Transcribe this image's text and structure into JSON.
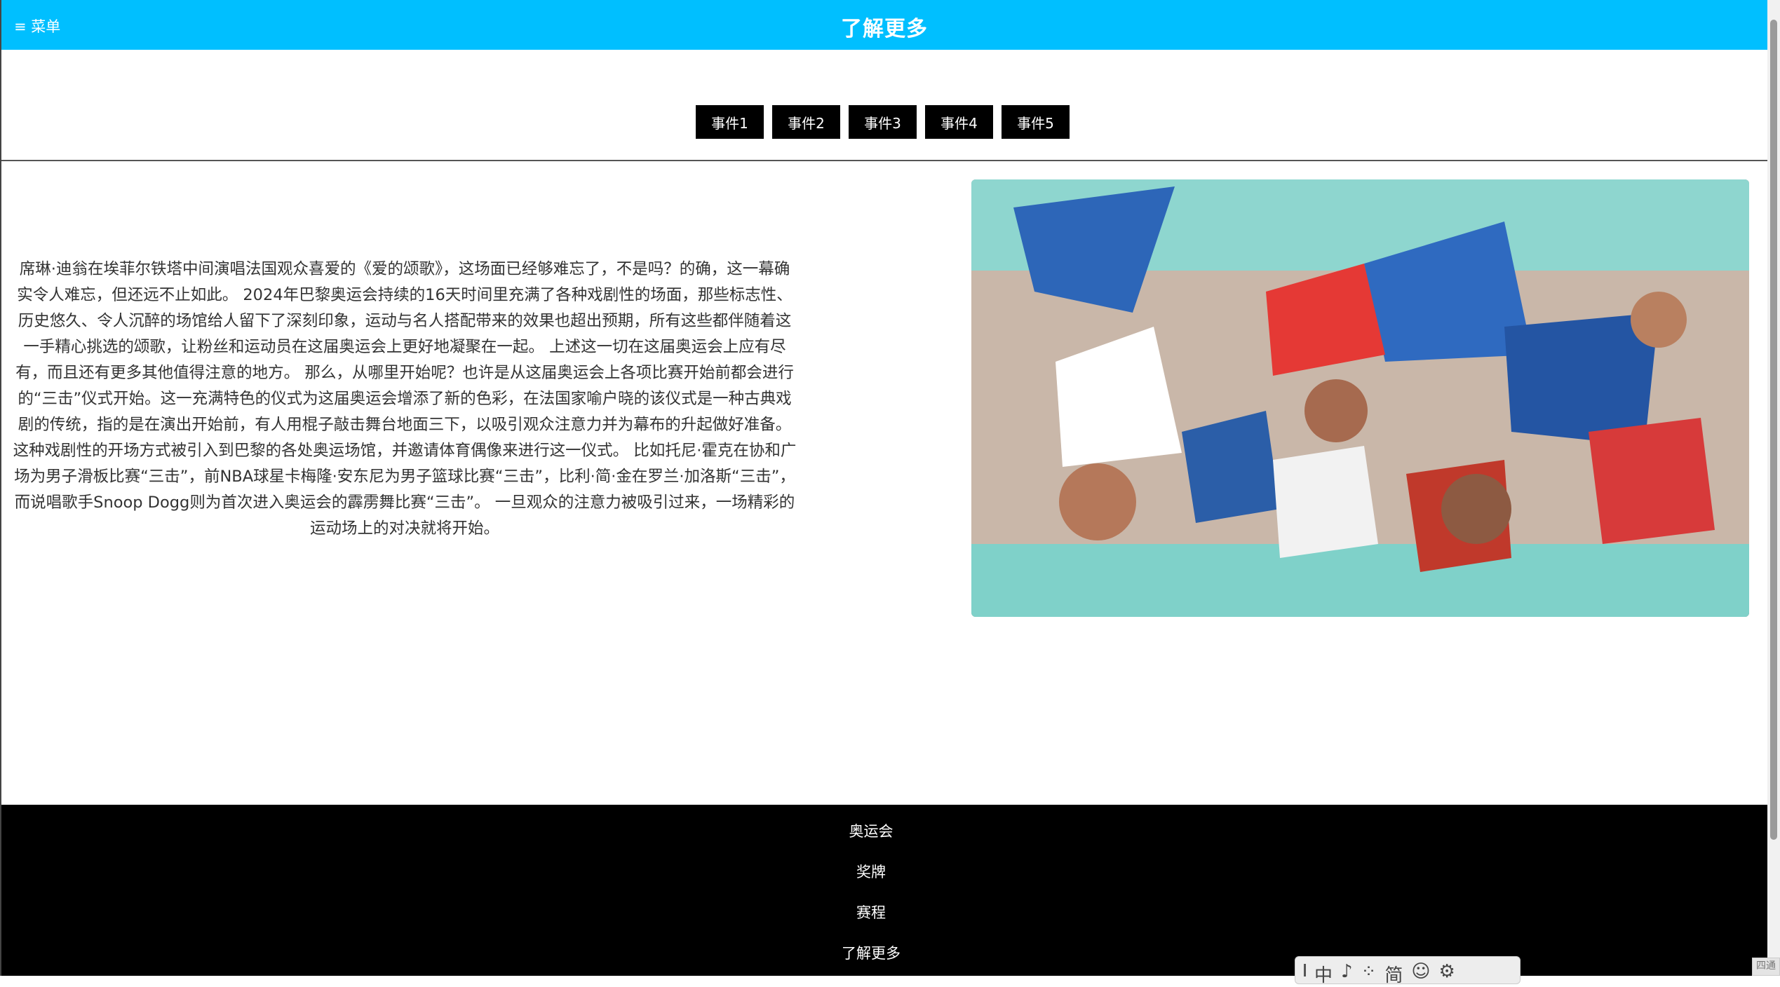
{
  "header": {
    "menu_icon": "hamburger-icon",
    "menu_label": "≡ 菜单",
    "title": "了解更多",
    "background": "#00bfff"
  },
  "events": [
    {
      "label": "事件1"
    },
    {
      "label": "事件2"
    },
    {
      "label": "事件3"
    },
    {
      "label": "事件4"
    },
    {
      "label": "事件5"
    }
  ],
  "article": {
    "text": "席琳·迪翁在埃菲尔铁塔中间演唱法国观众喜爱的《爱的颂歌》，这场面已经够难忘了，不是吗？的确，这一幕确实令人难忘，但还远不止如此。 2024年巴黎奥运会持续的16天时间里充满了各种戏剧性的场面，那些标志性、历史悠久、令人沉醉的场馆给人留下了深刻印象，运动与名人搭配带来的效果也超出预期，所有这些都伴随着这一手精心挑选的颂歌，让粉丝和运动员在这届奥运会上更好地凝聚在一起。 上述这一切在这届奥运会上应有尽有，而且还有更多其他值得注意的地方。 那么，从哪里开始呢？也许是从这届奥运会上各项比赛开始前都会进行的“三击”仪式开始。这一充满特色的仪式为这届奥运会增添了新的色彩，在法国家喻户晓的该仪式是一种古典戏剧的传统，指的是在演出开始前，有人用棍子敲击舞台地面三下，以吸引观众注意力并为幕布的升起做好准备。 这种戏剧性的开场方式被引入到巴黎的各处奥运场馆，并邀请体育偶像来进行这一仪式。 比如托尼·霍克在协和广场为男子滑板比赛“三击”，前NBA球星卡梅隆·安东尼为男子篮球比赛“三击”，比利·简·金在罗兰·加洛斯“三击”，而说唱歌手Snoop Dogg则为首次进入奥运会的霹雳舞比赛“三击”。 一旦观众的注意力被吸引过来，一场精彩的运动场上的对决就将开始。"
  },
  "photo": {
    "icon": "crowd-photo",
    "colors": [
      "#2d66b8",
      "#d92b2b",
      "#ffffff",
      "#7fd1c9"
    ]
  },
  "footer": {
    "links": [
      {
        "label": "奥运会"
      },
      {
        "label": "奖牌"
      },
      {
        "label": "赛程"
      },
      {
        "label": "了解更多"
      }
    ]
  },
  "ime": {
    "items": [
      "中",
      "♪",
      "⁘",
      "简",
      "☺",
      "⚙"
    ]
  },
  "corner": "四通"
}
